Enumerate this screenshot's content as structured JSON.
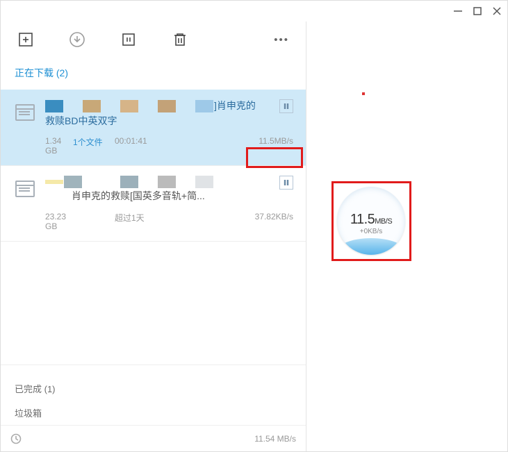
{
  "window": {},
  "sections": {
    "downloading_title": "正在下载 (2)",
    "completed_title": "已完成 (1)",
    "trash_title": "垃圾箱"
  },
  "items": [
    {
      "name_part1": "]肖申克的",
      "name_part2": "救赎BD中英双字",
      "size": "1.34 GB",
      "file_count": "1个文件",
      "time": "00:01:41",
      "speed": "11.5MB/s",
      "swatches": [
        "#3a8dc0",
        "#fff",
        "#c8a878",
        "#fff",
        "#d6b488",
        "#fff",
        "#c3a278",
        "#fff",
        "#9ec9e8"
      ]
    },
    {
      "name_part1": "",
      "name_part2": "肖申克的救赎[国英多音轨+简...",
      "size": "23.23 GB",
      "file_count": "",
      "time": "超过1天",
      "speed": "37.82KB/s",
      "swatches": [
        "#f5e9a8",
        "#a0b4bc",
        "#fff",
        "#fff",
        "#9cb0ba",
        "#fff",
        "#bbb",
        "#fff",
        "#e0e3e6"
      ]
    }
  ],
  "statusbar": {
    "speed": "11.54 MB/s"
  },
  "speed_widget": {
    "value": "11.5",
    "unit": "MB/S",
    "sub": "+0KB/s"
  }
}
